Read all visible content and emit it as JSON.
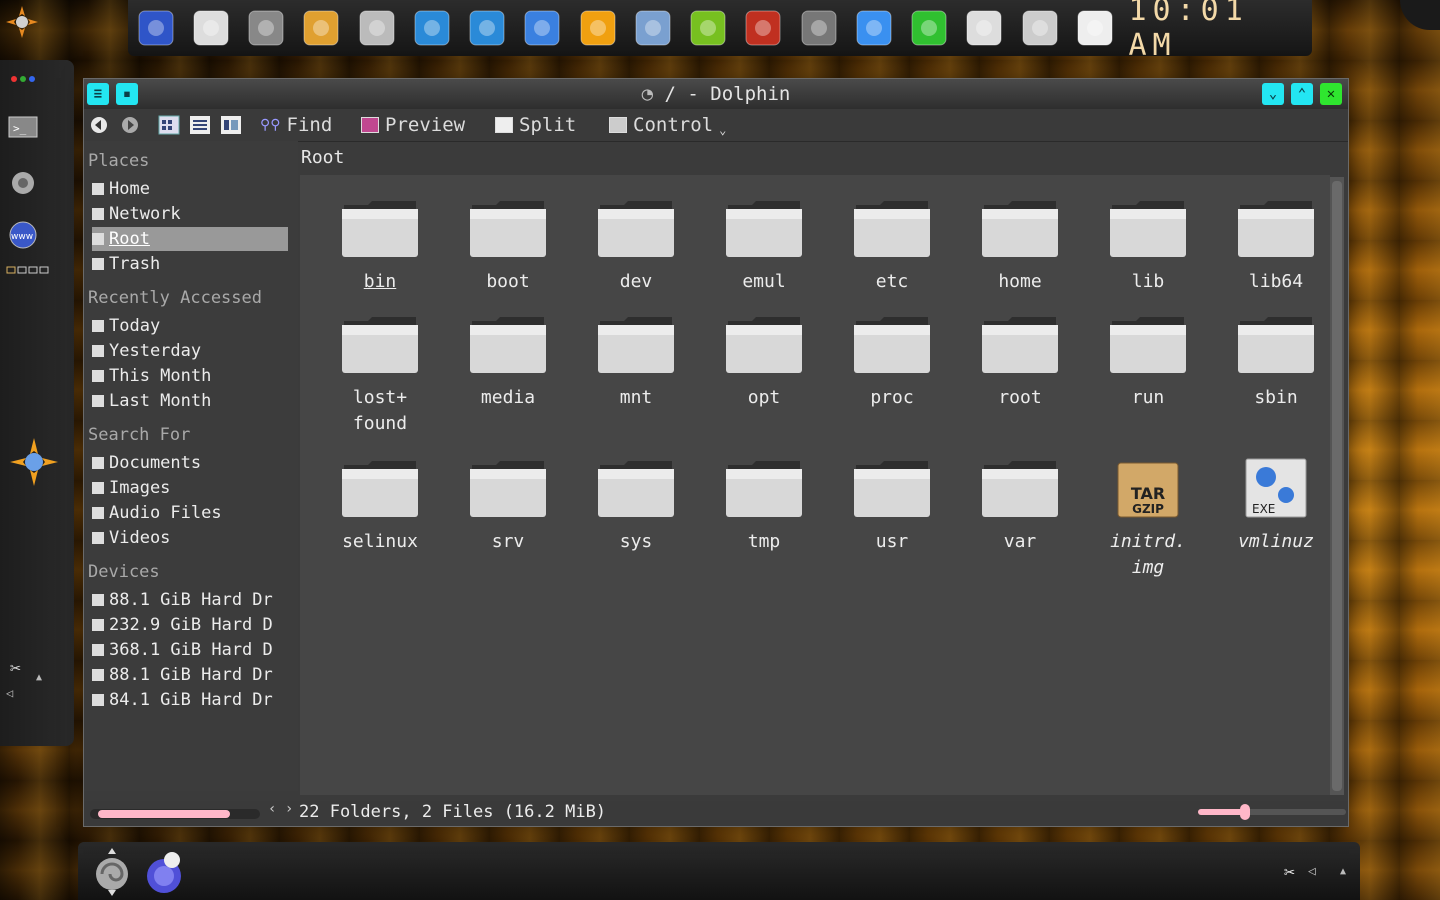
{
  "colors": {
    "accent_cyan": "#23e6f2",
    "accent_green": "#2fe62f",
    "selection": "#999999",
    "slider": "#ffb7c8"
  },
  "taskbar": {
    "launchers": [
      "web-browser-icon",
      "gimp-like-icon",
      "monitor-icon",
      "gimp-icon",
      "pen-icon",
      "sysmonitor-icon",
      "sysmonitor2-icon",
      "network-icon",
      "vlc-icon",
      "wallpaper-icon",
      "nvidia-icon",
      "rocket-icon",
      "terminal-icon",
      "download-icon",
      "wifi-icon",
      "calendar-icon",
      "tools-icon",
      "notes-icon"
    ],
    "clock": "10:01 AM"
  },
  "window": {
    "title": "/ - Dolphin",
    "toolbar": {
      "find": "Find",
      "preview": "Preview",
      "split": "Split",
      "control": "Control"
    },
    "places": {
      "places_heading": "Places",
      "places_items": [
        {
          "label": "Home"
        },
        {
          "label": "Network"
        },
        {
          "label": "Root"
        },
        {
          "label": "Trash"
        }
      ],
      "recent_heading": "Recently Accessed",
      "recent_items": [
        {
          "label": "Today"
        },
        {
          "label": "Yesterday"
        },
        {
          "label": "This Month"
        },
        {
          "label": "Last Month"
        }
      ],
      "search_heading": "Search For",
      "search_items": [
        {
          "label": "Documents"
        },
        {
          "label": "Images"
        },
        {
          "label": "Audio Files"
        },
        {
          "label": "Videos"
        }
      ],
      "devices_heading": "Devices",
      "devices_items": [
        {
          "label": "88.1 GiB Hard Dr"
        },
        {
          "label": "232.9 GiB Hard D"
        },
        {
          "label": "368.1 GiB Hard D"
        },
        {
          "label": "88.1 GiB Hard Dr"
        },
        {
          "label": "84.1 GiB Hard Dr"
        }
      ]
    },
    "breadcrumb": "Root",
    "files": [
      {
        "name": "bin",
        "type": "folder"
      },
      {
        "name": "boot",
        "type": "folder"
      },
      {
        "name": "dev",
        "type": "folder"
      },
      {
        "name": "emul",
        "type": "folder"
      },
      {
        "name": "etc",
        "type": "folder"
      },
      {
        "name": "home",
        "type": "folder"
      },
      {
        "name": "lib",
        "type": "folder"
      },
      {
        "name": "lib64",
        "type": "folder"
      },
      {
        "name": "lost+",
        "name2": "found",
        "type": "folder"
      },
      {
        "name": "media",
        "type": "folder"
      },
      {
        "name": "mnt",
        "type": "folder"
      },
      {
        "name": "opt",
        "type": "folder"
      },
      {
        "name": "proc",
        "type": "folder"
      },
      {
        "name": "root",
        "type": "folder"
      },
      {
        "name": "run",
        "type": "folder"
      },
      {
        "name": "sbin",
        "type": "folder"
      },
      {
        "name": "selinux",
        "type": "folder"
      },
      {
        "name": "srv",
        "type": "folder"
      },
      {
        "name": "sys",
        "type": "folder"
      },
      {
        "name": "tmp",
        "type": "folder"
      },
      {
        "name": "usr",
        "type": "folder"
      },
      {
        "name": "var",
        "type": "folder"
      },
      {
        "name": "initrd.",
        "name2": "img",
        "type": "tar",
        "badge1": "TAR",
        "badge2": "GZIP"
      },
      {
        "name": "vmlinuz",
        "type": "exe",
        "badge1": "EXE"
      }
    ],
    "status": "22 Folders, 2 Files (16.2 MiB)",
    "zoom_level": 0.32
  }
}
